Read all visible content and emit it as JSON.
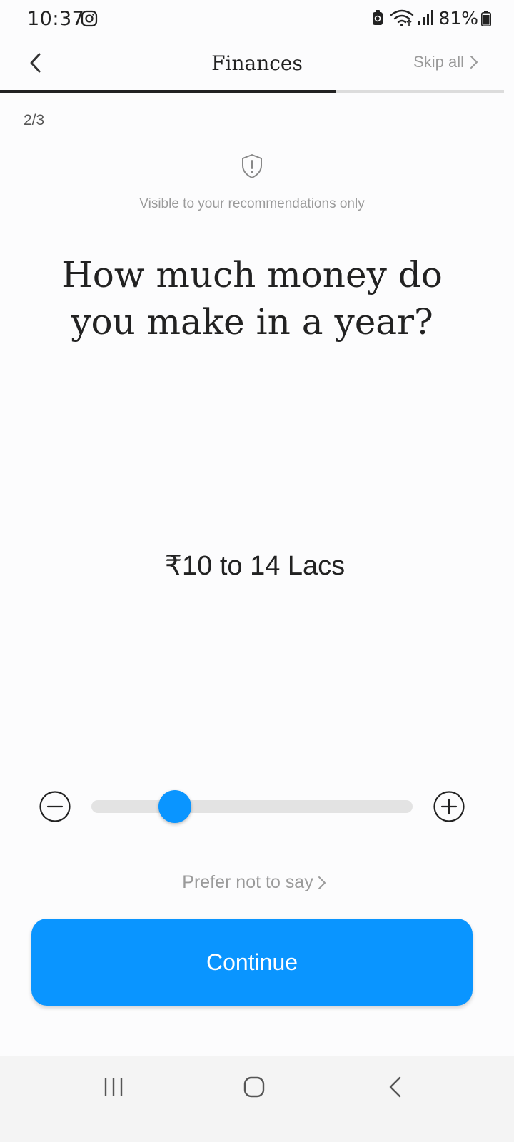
{
  "status_bar": {
    "time": "10:37",
    "battery_percent": "81%",
    "icons": [
      "instagram-icon",
      "battery-saver-icon",
      "wifi-icon",
      "signal-icon",
      "battery-icon"
    ]
  },
  "header": {
    "title": "Finances",
    "skip_label": "Skip all",
    "progress_fraction": 0.667
  },
  "step": {
    "counter": "2/3"
  },
  "privacy": {
    "icon": "shield-alert-icon",
    "note": "Visible to your recommendations only"
  },
  "question": {
    "text": "How much money do you make in a year?"
  },
  "income": {
    "value": "₹10 to 14 Lacs",
    "slider_fraction": 0.26
  },
  "actions": {
    "prefer_not_label": "Prefer not to say",
    "continue_label": "Continue"
  },
  "colors": {
    "accent": "#0a95ff",
    "text": "#222222",
    "muted": "#9a9a9a"
  }
}
